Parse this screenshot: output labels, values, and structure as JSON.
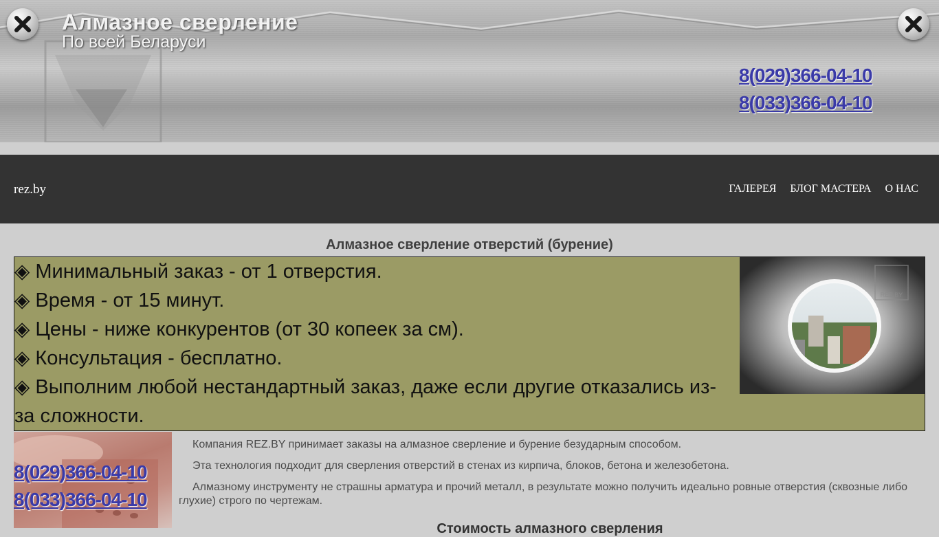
{
  "header": {
    "title": "Алмазное сверление",
    "subtitle": "По всей Беларуси",
    "phones": [
      "8(029)366-04-10",
      "8(033)366-04-10"
    ],
    "plate_text": "REZ.BY"
  },
  "nav": {
    "brand": "rez.by",
    "links": [
      "ГАЛЕРЕЯ",
      "БЛОГ МАСТЕРА",
      "О НАС"
    ]
  },
  "main": {
    "heading": "Алмазное сверление отверстий (бурение)",
    "features": [
      "◈ Минимальный заказ - от 1 отверстия.",
      "◈ Время - от 15 минут.",
      "◈ Цены - ниже конкурентов (от 30 копеек за см).",
      "◈ Консультация - бесплатно.",
      "◈ Выполним любой нестандартный заказ, даже если другие отказались из-за сложности."
    ],
    "photo_watermark": "REZ.BY",
    "side_phones": [
      "8(029)366-04-10",
      "8(033)366-04-10"
    ],
    "paragraphs": [
      "Компания REZ.BY принимает заказы на алмазное сверление и бурение безударным способом.",
      "Эта технология подходит для сверления отверстий в стенах из кирпича, блоков, бетона и железобетона.",
      "Алмазному инструменту не страшны арматура и прочий металл, в результате можно получить идеально ровные отверстия (сквозные либо глухие) строго по чертежам."
    ],
    "section_heading": "Стоимость алмазного сверления"
  },
  "colors": {
    "accent_link": "#3a3aa8",
    "nav_bg": "#333333",
    "feature_bg": "#9b9b65",
    "page_bg": "#cfcfcf"
  }
}
